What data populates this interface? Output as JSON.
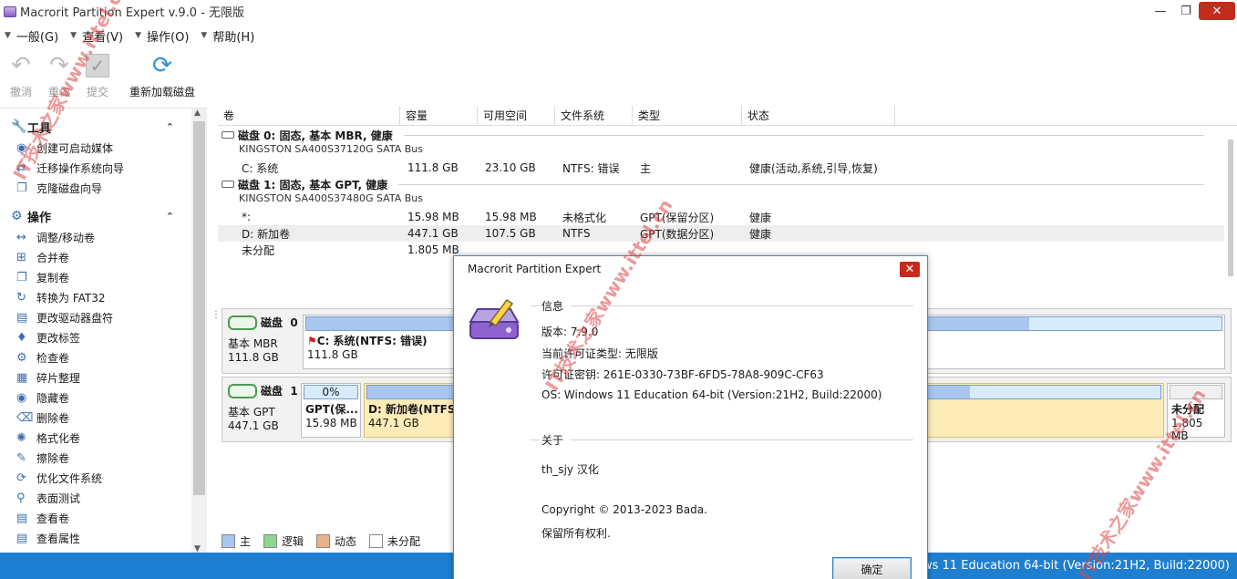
{
  "window": {
    "title": "Macrorit Partition Expert v.9.0 - 无限版"
  },
  "menu": [
    {
      "label": "一般(G)"
    },
    {
      "label": "查看(V)"
    },
    {
      "label": "操作(O)"
    },
    {
      "label": "帮助(H)"
    }
  ],
  "toolbar": {
    "undo": "撤消",
    "redo": "重做",
    "commit": "提交",
    "reload": "重新加载磁盘"
  },
  "sidebar": {
    "tools_title": "工具",
    "tools": [
      "创建可启动媒体",
      "迁移操作系统向导",
      "克隆磁盘向导"
    ],
    "ops_title": "操作",
    "ops": [
      "调整/移动卷",
      "合并卷",
      "复制卷",
      "转换为 FAT32",
      "更改驱动器盘符",
      "更改标签",
      "检查卷",
      "碎片整理",
      "隐藏卷",
      "删除卷",
      "格式化卷",
      "擦除卷",
      "优化文件系统",
      "表面测试",
      "查看卷",
      "查看属性"
    ]
  },
  "columns": [
    "卷",
    "容量",
    "可用空间",
    "文件系统",
    "类型",
    "状态"
  ],
  "disks": [
    {
      "title": "磁盘  0: 固态, 基本 MBR, 健康",
      "model": "KINGSTON SA400S37120G SATA Bus",
      "rows": [
        {
          "vol": "C: 系统",
          "cap": "111.8 GB",
          "free": "23.10 GB",
          "fs": "NTFS: 错误",
          "type": "主",
          "status": "健康(活动,系统,引导,恢复)"
        }
      ]
    },
    {
      "title": "磁盘  1: 固态, 基本 GPT, 健康",
      "model": "KINGSTON SA400S37480G SATA Bus",
      "rows": [
        {
          "vol": "*:",
          "cap": "15.98 MB",
          "free": "15.98 MB",
          "fs": "未格式化",
          "type": "GPT(保留分区)",
          "status": "健康"
        },
        {
          "vol": "D: 新加卷",
          "cap": "447.1 GB",
          "free": "107.5 GB",
          "fs": "NTFS",
          "type": "GPT(数据分区)",
          "status": "健康"
        },
        {
          "vol": "未分配",
          "cap": "1.805 MB",
          "free": "",
          "fs": "",
          "type": "",
          "status": ""
        }
      ]
    }
  ],
  "diskmap": {
    "d0": {
      "name": "磁盘",
      "num": "0",
      "kind": "基本 MBR",
      "size": "111.8 GB",
      "p1_name": "C: 系统(NTFS: 错误)",
      "p1_size": "111.8 GB"
    },
    "d1": {
      "name": "磁盘",
      "num": "1",
      "kind": "基本 GPT",
      "size": "447.1 GB",
      "p1_pct": "0%",
      "p1_name": "GPT(保...",
      "p1_size": "15.98 MB",
      "p2_name": "D: 新加卷(NTFS)",
      "p2_size": "447.1 GB",
      "p3_name": "未分配",
      "p3_size": "1.805 MB"
    }
  },
  "legend": [
    "主",
    "逻辑",
    "动态",
    "未分配"
  ],
  "legend_colors": [
    "#a9c6ef",
    "#8fd48f",
    "#e7b48a",
    "#ffffff"
  ],
  "statusbar": "Windows 11 Education 64-bit (Version:21H2, Build:22000)",
  "dialog": {
    "title": "Macrorit Partition Expert",
    "info_title": "信息",
    "version": "版本: 7.9.0",
    "license_type": "当前许可证类型: 无限版",
    "license_key": "许可证密钥: 261E-0330-73BF-6FD5-78A8-909C-CF63",
    "os": "OS: Windows 11 Education 64-bit (Version:21H2, Build:22000)",
    "about_title": "关于",
    "translator": "th_sjy 汉化",
    "copyright": "Copyright © 2013-2023 Bada.",
    "rights": "保留所有权利.",
    "ok": "确定"
  },
  "watermark": "IT技术之家www.ittel.cn"
}
